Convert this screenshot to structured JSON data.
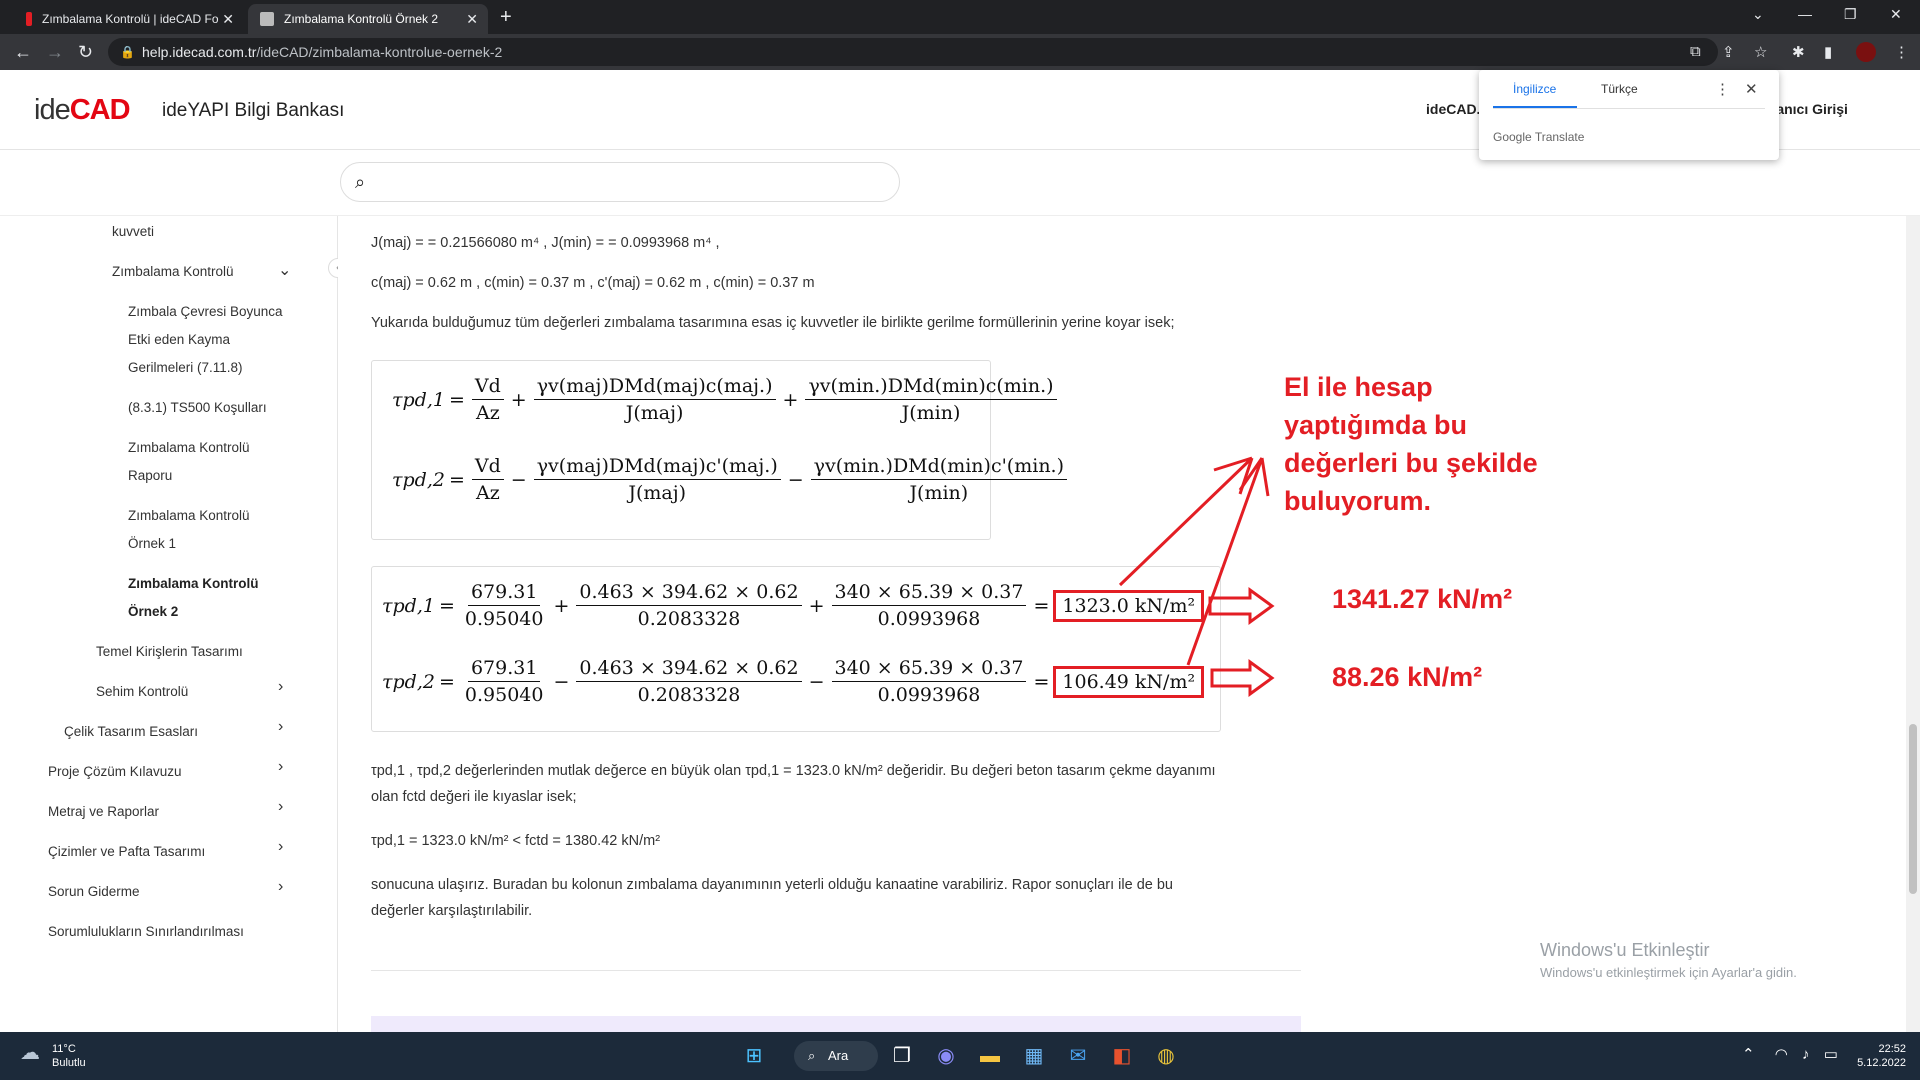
{
  "browser": {
    "tabs": [
      {
        "title": "Zımbalama Kontrolü | ideCAD Fo",
        "active": false
      },
      {
        "title": "Zımbalama Kontrolü Örnek 2",
        "active": true
      }
    ],
    "new_tab_label": "+",
    "url_host": "help.idecad.com.tr",
    "url_path": "/ideCAD/zimbalama-kontrolue-oernek-2"
  },
  "translate_popup": {
    "lang_from": "İngilizce",
    "lang_to": "Türkçe",
    "brand": "Google Translate"
  },
  "header": {
    "logo_ide": "ide",
    "logo_cad": "CAD",
    "site_title": "ideYAPI Bilgi Bankası",
    "nav_idecad": "ideCAD.c",
    "nav_login": "ullanıcı Girişi"
  },
  "search": {
    "placeholder": ""
  },
  "sidebar": {
    "items": [
      {
        "label": "kuvveti"
      },
      {
        "label": "Zımbalama Kontrolü"
      },
      {
        "label": "Zımbala Çevresi Boyunca"
      },
      {
        "label": "Etki eden Kayma"
      },
      {
        "label": "Gerilmeleri (7.11.8)"
      },
      {
        "label": "(8.3.1) TS500 Koşulları"
      },
      {
        "label": "Zımbalama Kontrolü"
      },
      {
        "label": "Raporu"
      },
      {
        "label": "Zımbalama Kontrolü"
      },
      {
        "label": "Örnek 1"
      },
      {
        "label": "Zımbalama Kontrolü"
      },
      {
        "label": "Örnek 2"
      },
      {
        "label": "Temel Kirişlerin Tasarımı"
      },
      {
        "label": "Sehim Kontrolü"
      },
      {
        "label": "Çelik Tasarım Esasları"
      },
      {
        "label": "Proje Çözüm Kılavuzu"
      },
      {
        "label": "Metraj ve Raporlar"
      },
      {
        "label": "Çizimler ve Pafta Tasarımı"
      },
      {
        "label": "Sorun Giderme"
      },
      {
        "label": "Sorumlulukların Sınırlandırılması"
      }
    ]
  },
  "content": {
    "line_j": "J(maj) = = 0.21566080 m⁴ , J(min) = = 0.0993968 m⁴ ,",
    "line_c": "c(maj) = 0.62 m , c(min) = 0.37 m , c'(maj) = 0.62 m , c(min) = 0.37 m",
    "intro": "Yukarıda bulduğumuz tüm değerleri zımbalama tasarımına esas iç kuvvetler ile birlikte gerilme formüllerinin yerine koyar isek;",
    "formula": {
      "lhs1": "τpd,1",
      "lhs2": "τpd,2",
      "vd": "Vd",
      "az": "Az",
      "t2num": "γv(maj)DMd(maj)c(maj.)",
      "t2den": "J(maj)",
      "t3num": "γv(min.)DMd(min)c(min.)",
      "t3den": "J(min)",
      "t2num_b": "γv(maj)DMd(maj)c'(maj.)",
      "t3num_b": "γv(min.)DMd(min)c'(min.)"
    },
    "numeric": {
      "n1": "679.31",
      "d1": "0.95040",
      "n2": "0.463 × 394.62 × 0.62",
      "d2": "0.2083328",
      "n3": "340 × 65.39 × 0.37",
      "d3": "0.0993968",
      "res1": "1323.0 kN/m²",
      "res2": "106.49 kN/m²"
    },
    "para_compare_1": "τpd,1 , τpd,2 değerlerinden mutlak değerce en büyük olan τpd,1 = 1323.0 kN/m² değeridir. Bu değeri beton tasarım çekme dayanımı",
    "para_compare_2": "olan fctd değeri ile kıyaslar isek;",
    "para_inequality": "τpd,1 = 1323.0 kN/m² < fctd = 1380.42 kN/m²",
    "para_conclusion_1": "sonucuna ulaşırız. Buradan bu kolonun zımbalama dayanımının yeterli olduğu kanaatine varabiliriz. Rapor sonuçları ile de bu",
    "para_conclusion_2": "değerler karşılaştırılabilir."
  },
  "annotations": {
    "lines": [
      "El ile hesap",
      "yaptığımda bu",
      "değerleri bu şekilde",
      "buluyorum."
    ],
    "value1": "1341.27 kN/m²",
    "value2": "88.26 kN/m²",
    "color": "#e31e24"
  },
  "windows_activation": {
    "title": "Windows'u Etkinleştir",
    "subtitle": "Windows'u etkinleştirmek için Ayarlar'a gidin."
  },
  "taskbar": {
    "weather_temp": "11°C",
    "weather_text": "Bulutlu",
    "search_label": "Ara",
    "time": "22:52",
    "date": "5.12.2022"
  }
}
